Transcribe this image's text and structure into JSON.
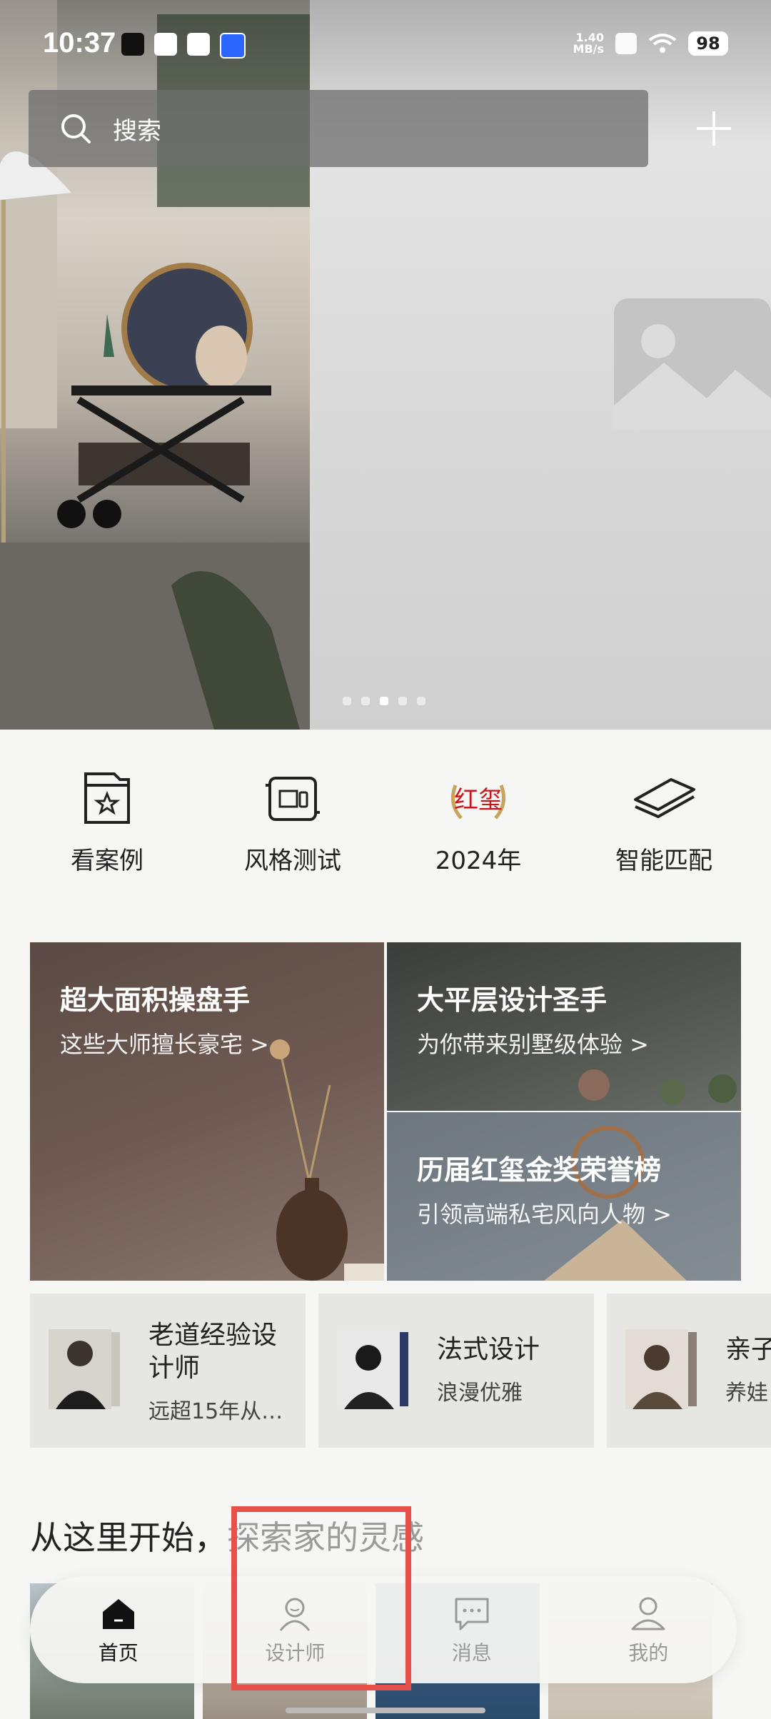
{
  "status_bar": {
    "time": "10:37",
    "net_speed_value": "1.40",
    "net_speed_unit": "MB/s",
    "battery": "98"
  },
  "search": {
    "placeholder": "搜索"
  },
  "carousel": {
    "total_dots": 5,
    "active_index": 2
  },
  "quick_actions": [
    {
      "label": "看案例",
      "icon": "star-folder-icon"
    },
    {
      "label": "风格测试",
      "icon": "style-test-icon"
    },
    {
      "label": "2024年",
      "icon": "award-laurel-icon",
      "badge_text": "红玺"
    },
    {
      "label": "智能匹配",
      "icon": "layers-icon"
    }
  ],
  "promo_cards": [
    {
      "title": "超大面积操盘手",
      "subtitle": "这些大师擅长豪宅 >"
    },
    {
      "title": "大平层设计圣手",
      "subtitle": "为你带来别墅级体验 >"
    },
    {
      "title": "历届红玺金奖荣誉榜",
      "subtitle": "引领高端私宅风向人物 >"
    }
  ],
  "designer_tags": [
    {
      "title": "老道经验设计师",
      "subtitle": "远超15年从…"
    },
    {
      "title": "法式设计",
      "subtitle": "浪漫优雅"
    },
    {
      "title": "亲子",
      "subtitle": "养娃"
    }
  ],
  "section": {
    "title_main": "从这里开始，",
    "title_highlight": "探索家的灵感"
  },
  "tab_bar": [
    {
      "label": "首页",
      "icon": "home-icon",
      "active": true
    },
    {
      "label": "设计师",
      "icon": "designer-icon",
      "active": false
    },
    {
      "label": "消息",
      "icon": "message-icon",
      "active": false
    },
    {
      "label": "我的",
      "icon": "profile-icon",
      "active": false
    }
  ],
  "colors": {
    "accent_red": "#c8161d",
    "highlight_box": "#e8504a",
    "gold": "#c9a45c"
  }
}
